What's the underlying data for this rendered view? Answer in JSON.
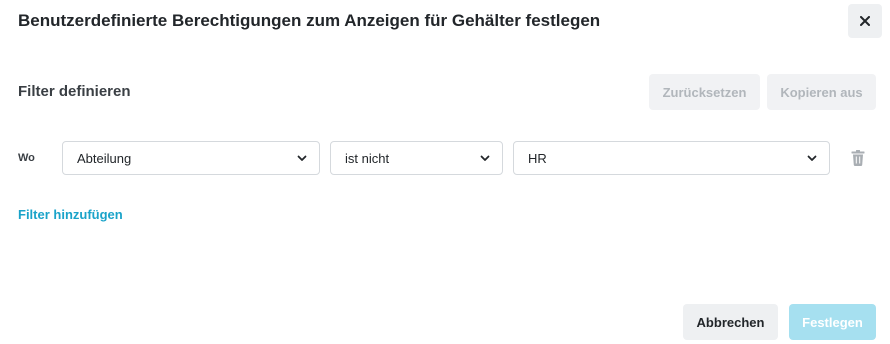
{
  "dialog": {
    "title": "Benutzerdefinierte Berechtigungen zum Anzeigen für Gehälter festlegen",
    "close_icon": "close-icon"
  },
  "filter_section": {
    "title": "Filter definieren",
    "reset_label": "Zurücksetzen",
    "copy_label": "Kopieren aus"
  },
  "filter_rows": [
    {
      "prefix": "Wo",
      "field": "Abteilung",
      "operator": "ist nicht",
      "value": "HR",
      "delete_icon": "trash-icon"
    }
  ],
  "add_filter_label": "Filter hinzufügen",
  "footer": {
    "cancel_label": "Abbrechen",
    "apply_label": "Festlegen"
  },
  "colors": {
    "accent": "#1aa3c9",
    "primary_disabled": "#a6e0f0",
    "secondary_bg": "#eef0f2",
    "disabled_text": "#b1b6bb"
  }
}
